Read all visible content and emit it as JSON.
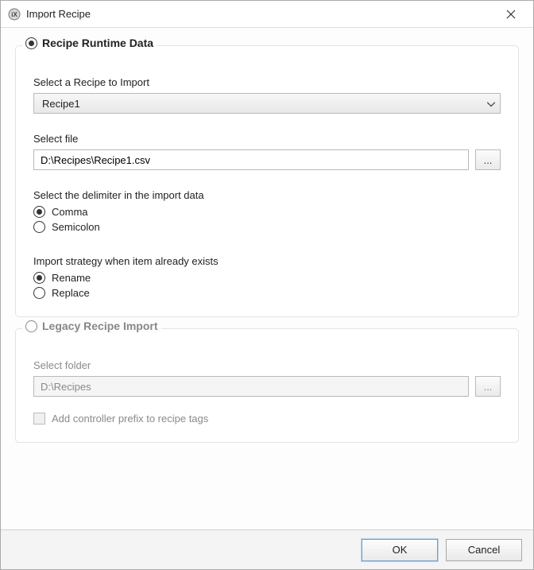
{
  "window": {
    "title": "Import Recipe"
  },
  "runtime": {
    "section_title": "Recipe Runtime Data",
    "select_recipe_label": "Select a Recipe to Import",
    "selected_recipe": "Recipe1",
    "select_file_label": "Select file",
    "file_path": "D:\\Recipes\\Recipe1.csv",
    "browse_label": "...",
    "delimiter_label": "Select the delimiter in the import data",
    "delimiter_options": {
      "comma": "Comma",
      "semicolon": "Semicolon"
    },
    "delimiter_selected": "comma",
    "strategy_label": "Import strategy when item already exists",
    "strategy_options": {
      "rename": "Rename",
      "replace": "Replace"
    },
    "strategy_selected": "rename"
  },
  "legacy": {
    "section_title": "Legacy Recipe Import",
    "select_folder_label": "Select folder",
    "folder_path": "D:\\Recipes",
    "browse_label": "...",
    "prefix_checkbox_label": "Add controller prefix to recipe tags",
    "prefix_checked": false
  },
  "mode_selected": "runtime",
  "footer": {
    "ok": "OK",
    "cancel": "Cancel"
  }
}
